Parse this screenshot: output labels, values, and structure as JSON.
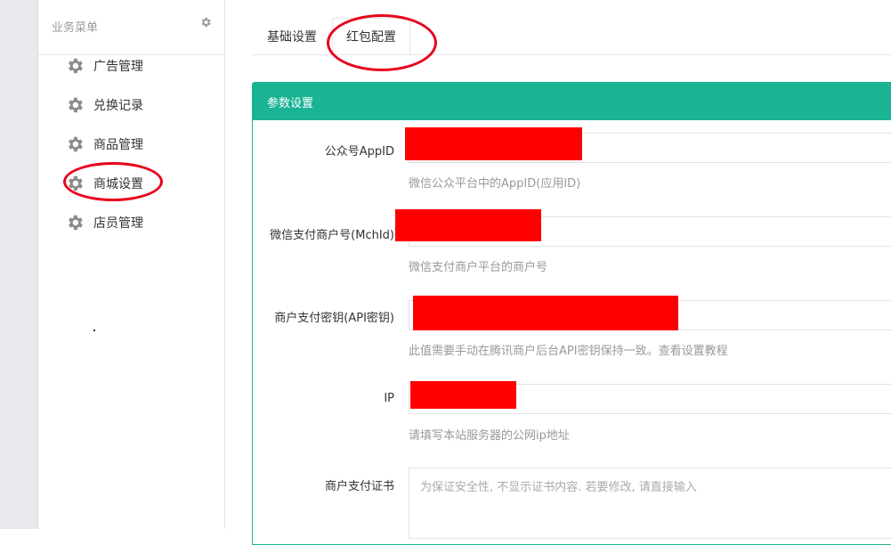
{
  "sidebar": {
    "title": "业务菜单",
    "items": [
      {
        "label": "广告管理",
        "icon": "gear-icon"
      },
      {
        "label": "兑换记录",
        "icon": "gear-icon"
      },
      {
        "label": "商品管理",
        "icon": "gear-icon"
      },
      {
        "label": "商城设置",
        "icon": "gear-icon"
      },
      {
        "label": "店员管理",
        "icon": "gear-icon"
      }
    ]
  },
  "tabs": [
    {
      "label": "基础设置",
      "active": false
    },
    {
      "label": "红包配置",
      "active": true
    }
  ],
  "panel": {
    "title": "参数设置",
    "fields": [
      {
        "label": "公众号AppID",
        "help": "微信公众平台中的AppID(应用ID)",
        "value": ""
      },
      {
        "label": "微信支付商户号(MchId)",
        "help": "微信支付商户平台的商户号",
        "value": ""
      },
      {
        "label": "商户支付密钥(API密钥)",
        "help": "此值需要手动在腾讯商户后台API密钥保持一致。查看设置教程",
        "value": ""
      },
      {
        "label": "IP",
        "help": "请填写本站服务器的公网ip地址",
        "value": ""
      }
    ],
    "cert": {
      "label": "商户支付证书",
      "placeholder": "为保证安全性, 不显示证书内容. 若要修改, 请直接输入"
    }
  },
  "colors": {
    "accent": "#1ab394",
    "annotation": "#e8001c",
    "redaction": "#ff0000"
  }
}
